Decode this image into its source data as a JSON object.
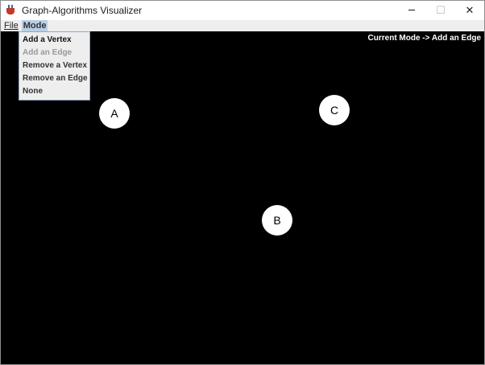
{
  "window": {
    "title": "Graph-Algorithms Visualizer",
    "controls": {
      "minimize": "─",
      "maximize": "☐",
      "close": "✕"
    }
  },
  "menubar": {
    "file": "File",
    "mode": "Mode"
  },
  "mode_menu": {
    "items": [
      {
        "label": "Add a Vertex",
        "state": "hover"
      },
      {
        "label": "Add an Edge",
        "state": "disabled"
      },
      {
        "label": "Remove a Vertex",
        "state": "normal"
      },
      {
        "label": "Remove an Edge",
        "state": "normal"
      },
      {
        "label": "None",
        "state": "normal"
      }
    ]
  },
  "canvas": {
    "current_mode_label": "Current Mode -> Add an Edge",
    "background": "#000000",
    "vertices": [
      {
        "label": "A"
      },
      {
        "label": "C"
      },
      {
        "label": "B"
      }
    ]
  },
  "colors": {
    "vertex_fill": "#ffffff",
    "menu_highlight": "#b8cfe5",
    "disabled_text": "#9a9a9a"
  },
  "icons": {
    "app": "java-cup-icon"
  }
}
